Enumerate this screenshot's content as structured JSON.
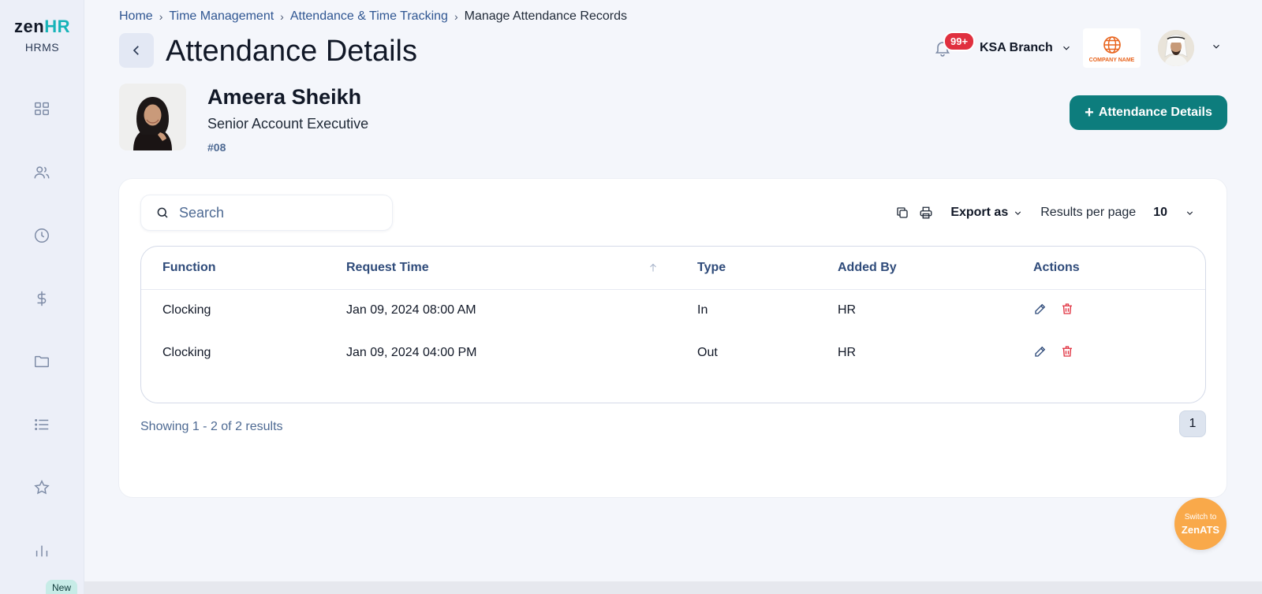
{
  "logo": {
    "zen": "zen",
    "hr": "HR",
    "subtitle": "HRMS"
  },
  "sidebar": {
    "icons": [
      "dashboard-icon",
      "people-icon",
      "clock-icon",
      "dollar-icon",
      "folder-icon",
      "list-icon",
      "star-icon",
      "bar-chart-icon"
    ],
    "new_badge": "New"
  },
  "breadcrumb": {
    "items": [
      "Home",
      "Time Management",
      "Attendance & Time Tracking"
    ],
    "current": "Manage Attendance Records"
  },
  "page": {
    "title": "Attendance Details"
  },
  "header": {
    "notifications": "99+",
    "branch": "KSA Branch",
    "company_name": "COMPANY NAME"
  },
  "employee": {
    "name": "Ameera Sheikh",
    "role": "Senior Account Executive",
    "id": "#08"
  },
  "actions": {
    "add_button": "Attendance Details",
    "add_plus": "+"
  },
  "toolbar": {
    "search_placeholder": "Search",
    "export_label": "Export as",
    "results_per_page_label": "Results per page",
    "results_per_page_value": "10"
  },
  "table": {
    "columns": [
      "Function",
      "Request Time",
      "Type",
      "Added By",
      "Actions"
    ],
    "rows": [
      {
        "function": "Clocking",
        "request_time": "Jan 09, 2024 08:00 AM",
        "type": "In",
        "added_by": "HR"
      },
      {
        "function": "Clocking",
        "request_time": "Jan 09, 2024 04:00 PM",
        "type": "Out",
        "added_by": "HR"
      }
    ]
  },
  "footer": {
    "showing": "Showing 1 - 2 of 2 results",
    "current_page": "1"
  },
  "switch_ats": {
    "line1": "Switch to",
    "line2": "ZenATS"
  },
  "colors": {
    "accent": "#0d7d7d",
    "brand_teal": "#17b3b8",
    "danger": "#e0303f",
    "switch": "#f9a94a"
  }
}
